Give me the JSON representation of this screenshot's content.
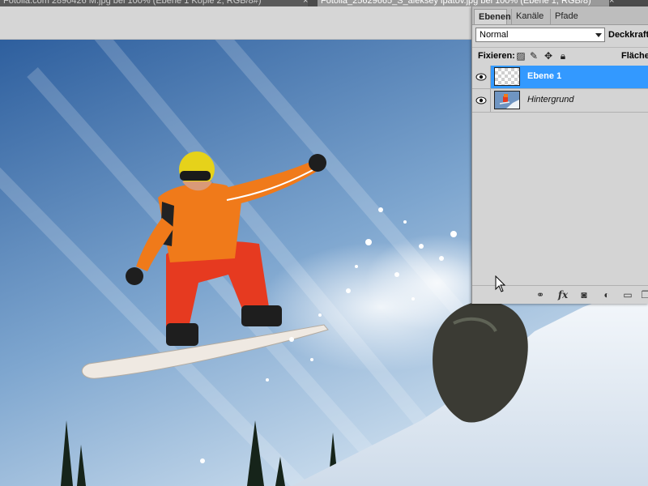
{
  "document_tabs": [
    {
      "label": "Fotolia.com 2890426 M.jpg bei 100% (Ebene 1 Kopie 2, RGB/8#)",
      "active": false
    },
    {
      "label": "Fotolia_25629665_S_aleksey ipatov.jpg bei 100% (Ebene 1, RGB/8)",
      "active": true
    }
  ],
  "tab_close_glyph": "×",
  "panel": {
    "tabs": [
      "Ebenen",
      "Kanäle",
      "Pfade"
    ],
    "blend_mode": "Normal",
    "opacity_label": "Deckkraft:",
    "lock_label": "Fixieren:",
    "fill_label": "Fläche:",
    "layers": [
      {
        "name": "Ebene 1",
        "selected": true,
        "thumb": "transparent-checker"
      },
      {
        "name": "Hintergrund",
        "selected": false,
        "thumb": "photo"
      }
    ],
    "footer_icons": [
      "link-icon",
      "fx-icon",
      "mask-icon",
      "adjustment-icon",
      "folder-icon",
      "new-layer-icon"
    ]
  },
  "colors": {
    "selected_layer": "#3399ff",
    "panel_bg": "#d4d4d4",
    "sky_top": "#2e5f9e",
    "sky_bottom": "#cfe0ef",
    "jacket": "#f07a1a",
    "pants": "#e63a20"
  }
}
